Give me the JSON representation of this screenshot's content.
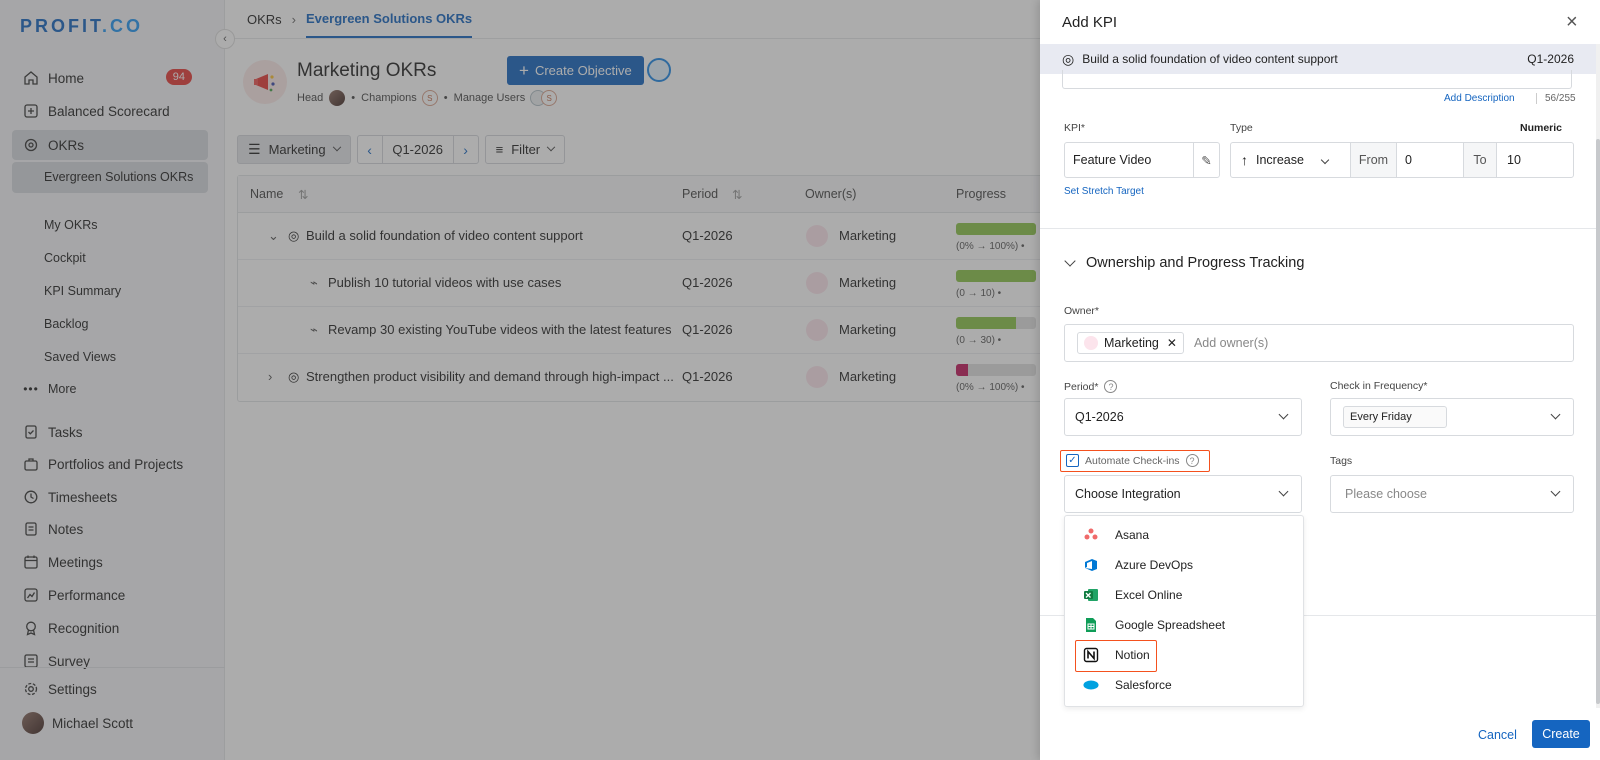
{
  "sidebar": {
    "logo_main": "PROFIT",
    "logo_suffix": ".CO",
    "home": "Home",
    "home_badge": "94",
    "balanced_scorecard": "Balanced Scorecard",
    "okrs": "OKRs",
    "sub_items": [
      "Evergreen Solutions OKRs",
      "My OKRs",
      "Cockpit",
      "KPI Summary",
      "Backlog",
      "Saved Views"
    ],
    "more": "More",
    "items": [
      "Tasks",
      "Portfolios and Projects",
      "Timesheets",
      "Notes",
      "Meetings",
      "Performance",
      "Recognition",
      "Survey"
    ],
    "settings": "Settings",
    "user": "Michael Scott"
  },
  "breadcrumb": {
    "root": "OKRs",
    "current": "Evergreen Solutions OKRs"
  },
  "page": {
    "title": "Marketing OKRs",
    "create_objective": "Create Objective",
    "head_label": "Head",
    "champions_label": "Champions",
    "manage_users_label": "Manage Users",
    "champion_initial": "S"
  },
  "toolbar": {
    "group": "Marketing",
    "period": "Q1-2026",
    "filter": "Filter"
  },
  "table": {
    "headers": {
      "name": "Name",
      "period": "Period",
      "owners": "Owner(s)",
      "progress": "Progress"
    },
    "rows": [
      {
        "name": "Build a solid foundation of video content support",
        "period": "Q1-2026",
        "owner": "Marketing",
        "progress_text": "(0% → 100%) •",
        "progress": 1.0,
        "color": "#8bc34a"
      },
      {
        "name": "Publish 10 tutorial videos with use cases",
        "period": "Q1-2026",
        "owner": "Marketing",
        "progress_text": "(0 → 10) •",
        "progress": 1.0,
        "color": "#8bc34a"
      },
      {
        "name": "Revamp 30 existing YouTube videos with the latest features",
        "period": "Q1-2026",
        "owner": "Marketing",
        "progress_text": "(0 → 30) •",
        "progress": 0.75,
        "color": "#8bc34a"
      },
      {
        "name": "Strengthen product visibility and demand through high-impact ...",
        "period": "Q1-2026",
        "owner": "Marketing",
        "progress_text": "(0% → 100%) •",
        "progress": 0.15,
        "color": "#c2185b"
      }
    ]
  },
  "drawer": {
    "title": "Add KPI",
    "objective": "Build a solid foundation of video content support",
    "objective_period": "Q1-2026",
    "add_description": "Add Description",
    "char_count": "56/255",
    "kpi_label": "KPI*",
    "kpi_value": "Feature Video",
    "type_label": "Type",
    "numeric_label": "Numeric",
    "type_value": "Increase",
    "from_label": "From",
    "from_value": "0",
    "to_label": "To",
    "to_value": "10",
    "stretch_target": "Set Stretch Target",
    "section_title": "Ownership and Progress Tracking",
    "owner_label": "Owner*",
    "owner_chip": "Marketing",
    "owner_placeholder": "Add owner(s)",
    "period_label": "Period*",
    "period_value": "Q1-2026",
    "checkin_label": "Check in Frequency*",
    "checkin_value": "Every Friday",
    "automate_label": "Automate Check-ins",
    "tags_label": "Tags",
    "tags_placeholder": "Please choose",
    "integration_placeholder": "Choose Integration",
    "integrations": [
      "Asana",
      "Azure DevOps",
      "Excel Online",
      "Google Spreadsheet",
      "Notion",
      "Salesforce"
    ],
    "cancel": "Cancel",
    "create": "Create"
  },
  "colors": {
    "accent": "#1565c0",
    "highlight": "#f4511e",
    "badge": "#e53935"
  }
}
